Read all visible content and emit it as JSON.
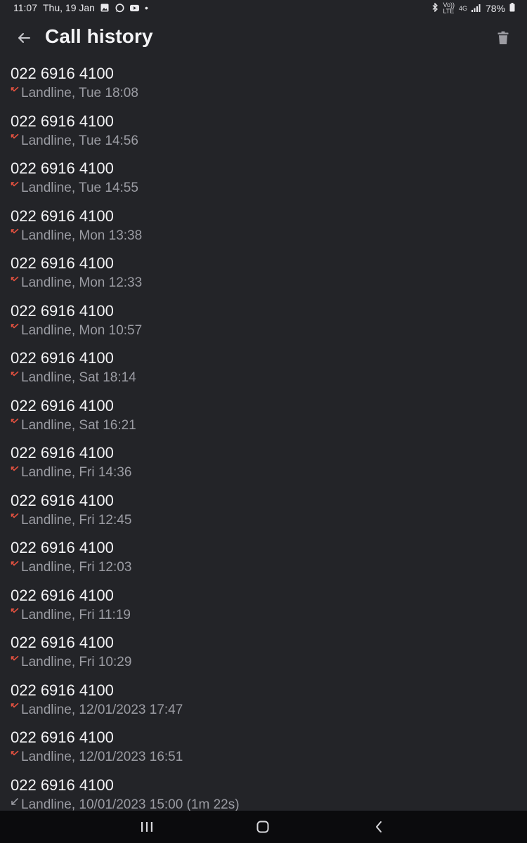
{
  "status_bar": {
    "time": "11:07",
    "date": "Thu, 19 Jan",
    "dot": "•",
    "volte_text": "Vo))\nLTE",
    "net_text": "4G",
    "battery": "78%",
    "notification_icons": [
      "gallery-icon",
      "whatsapp-icon",
      "youtube-icon"
    ]
  },
  "header": {
    "title": "Call history"
  },
  "calls": [
    {
      "number": "022 6916 4100",
      "detail": "Landline, Tue 18:08",
      "type": "missed"
    },
    {
      "number": "022 6916 4100",
      "detail": "Landline, Tue 14:56",
      "type": "missed"
    },
    {
      "number": "022 6916 4100",
      "detail": "Landline, Tue 14:55",
      "type": "missed"
    },
    {
      "number": "022 6916 4100",
      "detail": "Landline, Mon 13:38",
      "type": "missed"
    },
    {
      "number": "022 6916 4100",
      "detail": "Landline, Mon 12:33",
      "type": "missed"
    },
    {
      "number": "022 6916 4100",
      "detail": "Landline, Mon 10:57",
      "type": "missed"
    },
    {
      "number": "022 6916 4100",
      "detail": "Landline, Sat 18:14",
      "type": "missed"
    },
    {
      "number": "022 6916 4100",
      "detail": "Landline, Sat 16:21",
      "type": "missed"
    },
    {
      "number": "022 6916 4100",
      "detail": "Landline, Fri 14:36",
      "type": "missed"
    },
    {
      "number": "022 6916 4100",
      "detail": "Landline, Fri 12:45",
      "type": "missed"
    },
    {
      "number": "022 6916 4100",
      "detail": "Landline, Fri 12:03",
      "type": "missed"
    },
    {
      "number": "022 6916 4100",
      "detail": "Landline, Fri 11:19",
      "type": "missed"
    },
    {
      "number": "022 6916 4100",
      "detail": "Landline, Fri 10:29",
      "type": "missed"
    },
    {
      "number": "022 6916 4100",
      "detail": "Landline, 12/01/2023 17:47",
      "type": "missed"
    },
    {
      "number": "022 6916 4100",
      "detail": "Landline, 12/01/2023 16:51",
      "type": "missed"
    },
    {
      "number": "022 6916 4100",
      "detail": "Landline, 10/01/2023 15:00 (1m 22s)",
      "type": "incoming"
    }
  ],
  "colors": {
    "background": "#232428",
    "missed": "#e0503f",
    "incoming": "#9b9ca3",
    "nav_bar": "#0b0b0d"
  }
}
